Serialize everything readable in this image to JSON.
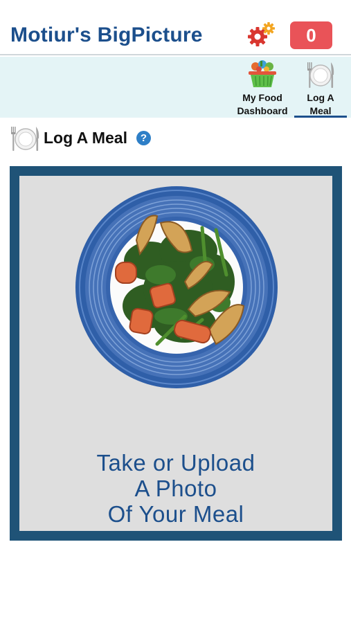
{
  "header": {
    "title": "Motiur's BigPicture",
    "settings_icon": "gears-icon",
    "notification_count": "0"
  },
  "nav": {
    "items": [
      {
        "label_line1": "My Food",
        "label_line2": "Dashboard",
        "icon": "food-basket-icon",
        "active": false
      },
      {
        "label_line1": "Log A",
        "label_line2": "Meal",
        "icon": "plate-fork-knife-icon",
        "active": true
      }
    ]
  },
  "section": {
    "title": "Log A Meal",
    "icon": "plate-fork-knife-icon",
    "help": "?"
  },
  "photo_card": {
    "image": "meal-plate-photo",
    "cta_line1": "Take or Upload",
    "cta_line2": "A Photo",
    "cta_line3": "Of Your Meal"
  },
  "colors": {
    "brand_blue": "#1c4f8c",
    "badge_red": "#e95358",
    "nav_bg": "#e4f4f6",
    "card_border": "#1f5377",
    "card_bg": "#dedede",
    "help_blue": "#2e7fc7"
  }
}
